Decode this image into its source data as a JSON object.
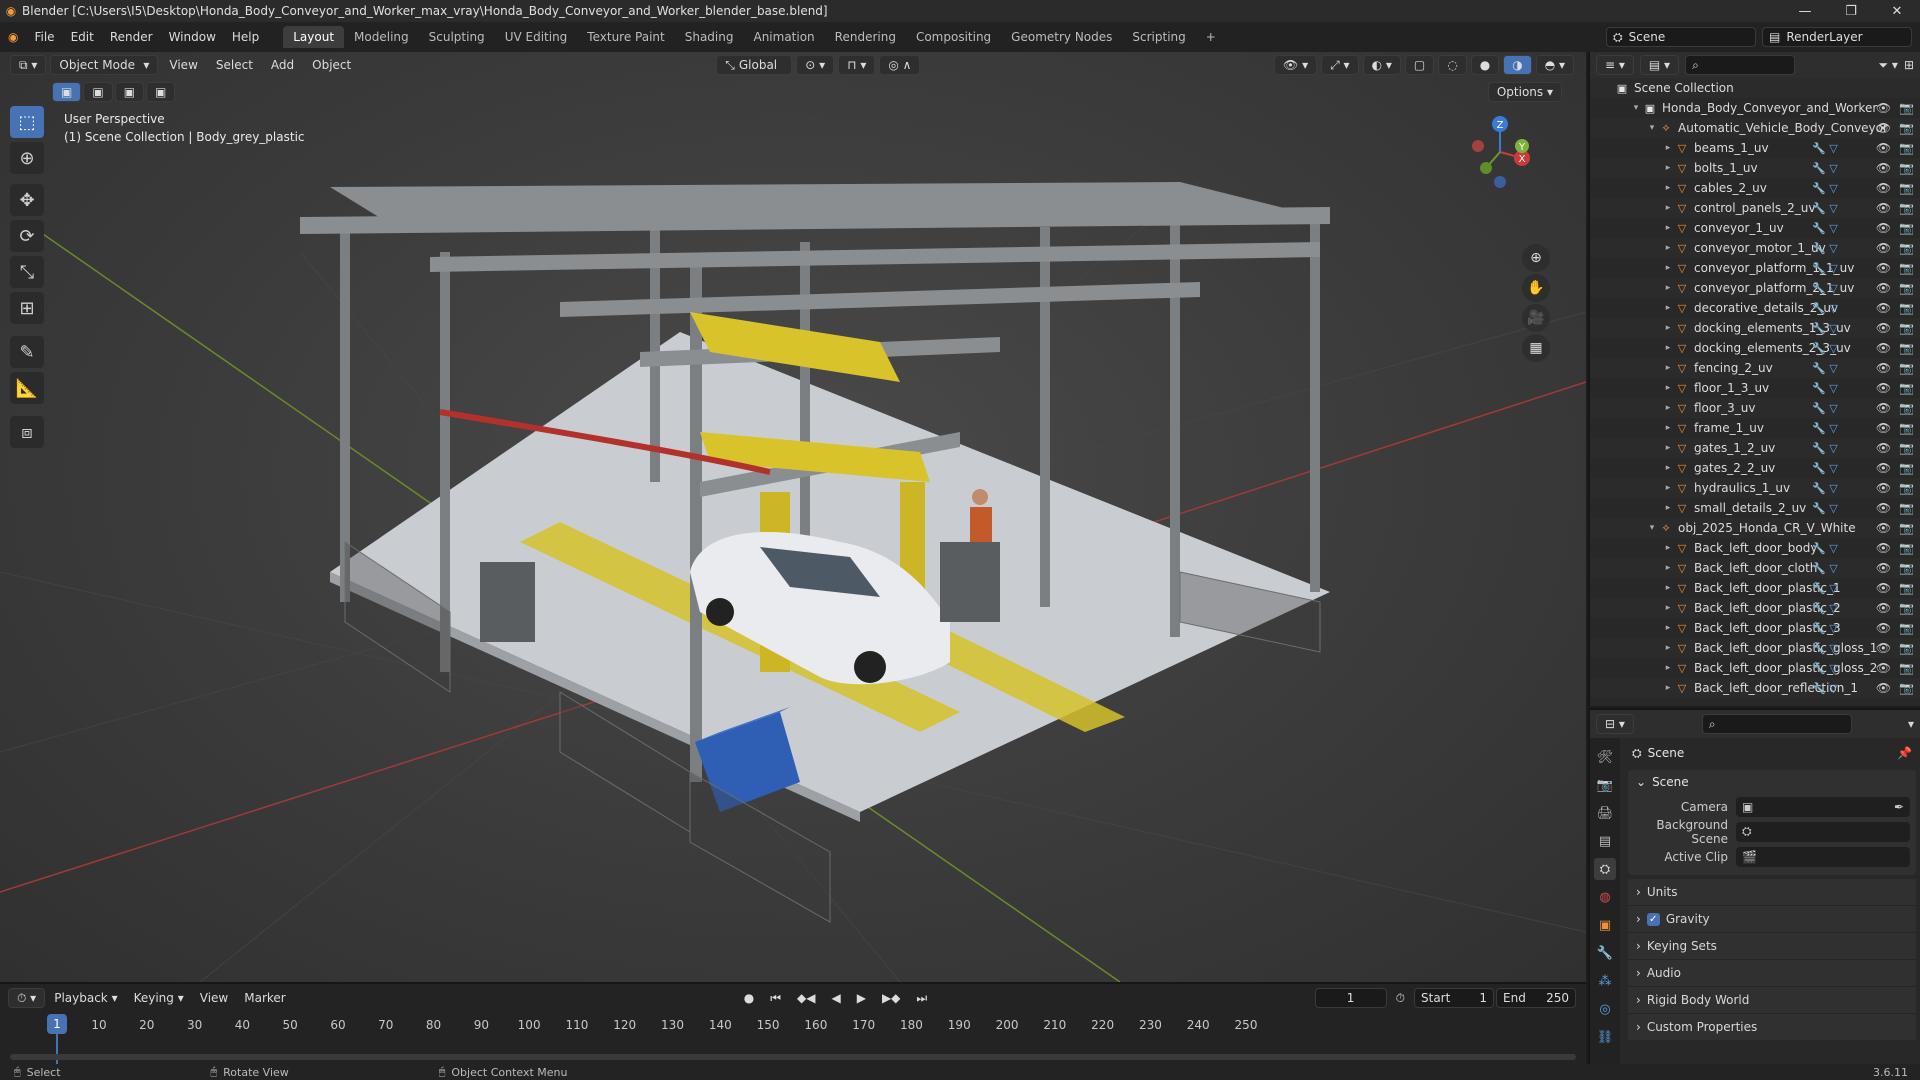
{
  "window": {
    "title": "Blender [C:\\Users\\I5\\Desktop\\Honda_Body_Conveyor_and_Worker_max_vray\\Honda_Body_Conveyor_and_Worker_blender_base.blend]"
  },
  "menu": [
    "File",
    "Edit",
    "Render",
    "Window",
    "Help"
  ],
  "workspaces": [
    "Layout",
    "Modeling",
    "Sculpting",
    "UV Editing",
    "Texture Paint",
    "Shading",
    "Animation",
    "Rendering",
    "Compositing",
    "Geometry Nodes",
    "Scripting"
  ],
  "active_workspace": "Layout",
  "scene_name": "Scene",
  "render_layer": "RenderLayer",
  "viewport": {
    "mode": "Object Mode",
    "menus": [
      "View",
      "Select",
      "Add",
      "Object"
    ],
    "orientation": "Global",
    "options_label": "Options",
    "perspective": "User Perspective",
    "context": "(1) Scene Collection | Body_grey_plastic",
    "gizmo_axes": {
      "z": "Z",
      "y": "Y",
      "x": "X"
    }
  },
  "outliner": {
    "root": "Scene Collection",
    "rows": [
      {
        "label": "Honda_Body_Conveyor_and_Worker",
        "type": "collection"
      },
      {
        "label": "Automatic_Vehicle_Body_Conveyor",
        "type": "empty"
      },
      {
        "label": "beams_1_uv",
        "type": "object"
      },
      {
        "label": "bolts_1_uv",
        "type": "object"
      },
      {
        "label": "cables_2_uv",
        "type": "object"
      },
      {
        "label": "control_panels_2_uv",
        "type": "object"
      },
      {
        "label": "conveyor_1_uv",
        "type": "object"
      },
      {
        "label": "conveyor_motor_1_uv",
        "type": "object"
      },
      {
        "label": "conveyor_platform_1_1_uv",
        "type": "object"
      },
      {
        "label": "conveyor_platform_2_1_uv",
        "type": "object"
      },
      {
        "label": "decorative_details_2_uv",
        "type": "object"
      },
      {
        "label": "docking_elements_1_3_uv",
        "type": "object"
      },
      {
        "label": "docking_elements_2_3_uv",
        "type": "object"
      },
      {
        "label": "fencing_2_uv",
        "type": "object"
      },
      {
        "label": "floor_1_3_uv",
        "type": "object"
      },
      {
        "label": "floor_3_uv",
        "type": "object"
      },
      {
        "label": "frame_1_uv",
        "type": "object"
      },
      {
        "label": "gates_1_2_uv",
        "type": "object"
      },
      {
        "label": "gates_2_2_uv",
        "type": "object"
      },
      {
        "label": "hydraulics_1_uv",
        "type": "object"
      },
      {
        "label": "small_details_2_uv",
        "type": "object"
      },
      {
        "label": "obj_2025_Honda_CR_V_White",
        "type": "empty"
      },
      {
        "label": "Back_left_door_body",
        "type": "object"
      },
      {
        "label": "Back_left_door_cloth",
        "type": "object"
      },
      {
        "label": "Back_left_door_plastic_1",
        "type": "object"
      },
      {
        "label": "Back_left_door_plastic_2",
        "type": "object"
      },
      {
        "label": "Back_left_door_plastic_3",
        "type": "object"
      },
      {
        "label": "Back_left_door_plastic_gloss_1",
        "type": "object"
      },
      {
        "label": "Back_left_door_plastic_gloss_2",
        "type": "object"
      },
      {
        "label": "Back_left_door_reflection_1",
        "type": "object"
      }
    ]
  },
  "properties": {
    "header": "Scene",
    "panel_title": "Scene",
    "fields": [
      {
        "label": "Camera",
        "value": ""
      },
      {
        "label": "Background Scene",
        "value": ""
      },
      {
        "label": "Active Clip",
        "value": ""
      }
    ],
    "subpanels": [
      "Units",
      "Gravity",
      "Keying Sets",
      "Audio",
      "Rigid Body World",
      "Custom Properties"
    ],
    "gravity_checked": true
  },
  "timeline": {
    "menus": [
      "Playback",
      "Keying",
      "View",
      "Marker"
    ],
    "current_frame": "1",
    "start_label": "Start",
    "start": "1",
    "end_label": "End",
    "end": "250",
    "ticks": [
      "10",
      "20",
      "30",
      "40",
      "50",
      "60",
      "70",
      "80",
      "90",
      "100",
      "110",
      "120",
      "130",
      "140",
      "150",
      "160",
      "170",
      "180",
      "190",
      "200",
      "210",
      "220",
      "230",
      "240",
      "250"
    ]
  },
  "status": {
    "select": "Select",
    "rotate": "Rotate View",
    "context_menu": "Object Context Menu",
    "version": "3.6.11"
  }
}
